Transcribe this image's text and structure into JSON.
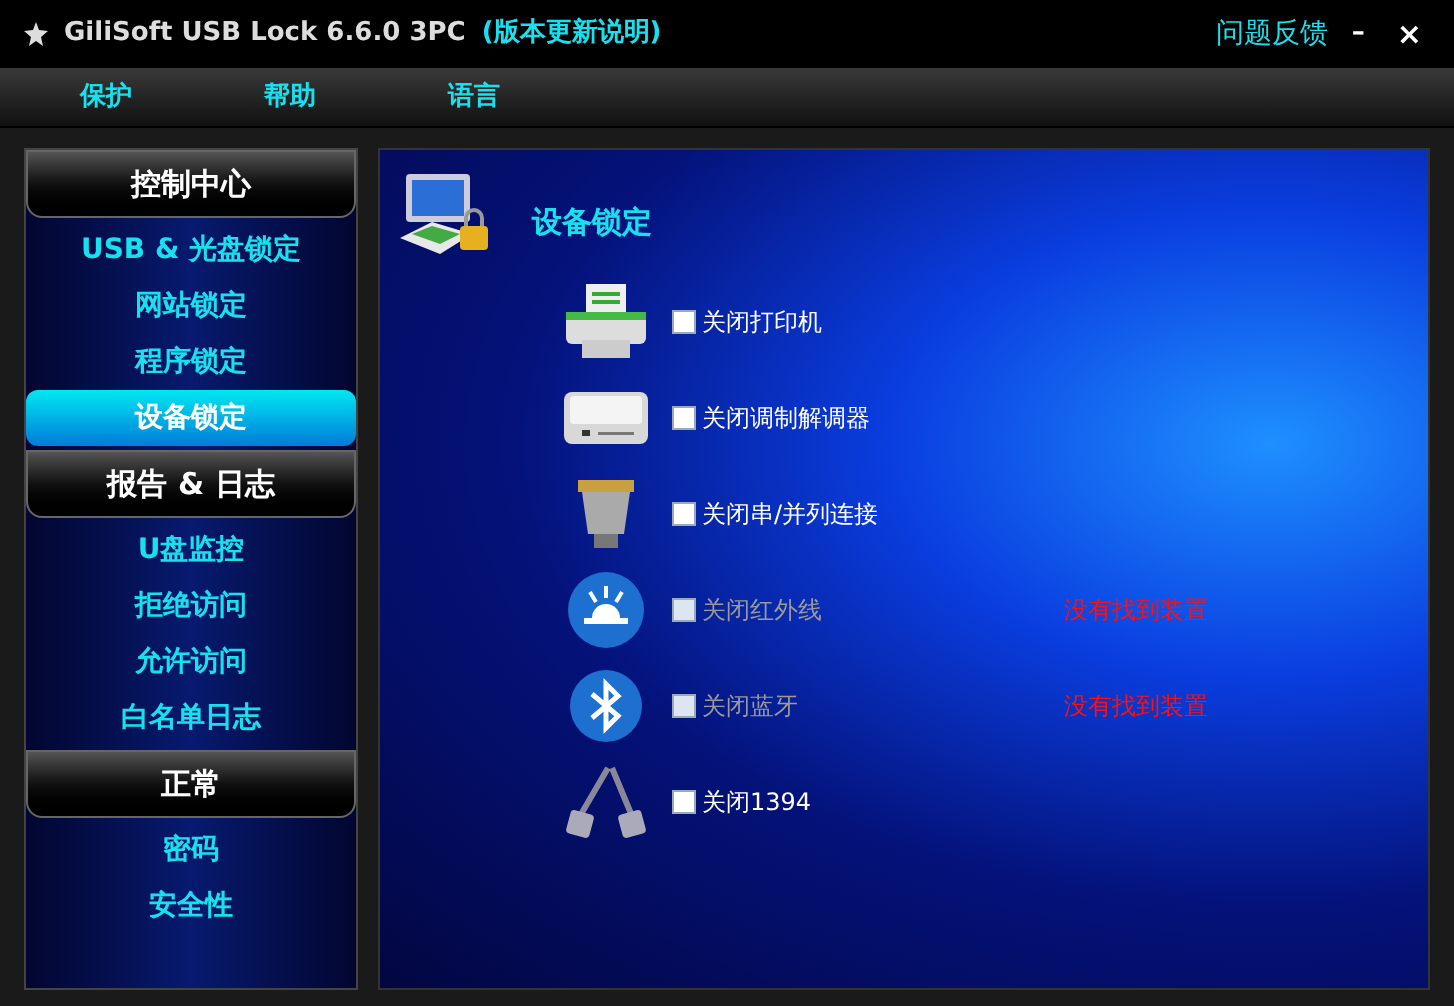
{
  "window": {
    "title": "GiliSoft USB Lock 6.6.0 3PC",
    "title_link": "(版本更新说明)",
    "feedback": "问题反馈",
    "minimize": "–",
    "close": "×"
  },
  "menu": [
    "保护",
    "帮助",
    "语言"
  ],
  "sidebar": [
    {
      "header": "控制中心",
      "items": [
        {
          "label": "USB & 光盘锁定",
          "selected": false
        },
        {
          "label": "网站锁定",
          "selected": false
        },
        {
          "label": "程序锁定",
          "selected": false
        },
        {
          "label": "设备锁定",
          "selected": true
        }
      ]
    },
    {
      "header": "报告 & 日志",
      "items": [
        {
          "label": "U盘监控",
          "selected": false
        },
        {
          "label": "拒绝访问",
          "selected": false
        },
        {
          "label": "允许访问",
          "selected": false
        },
        {
          "label": "白名单日志",
          "selected": false
        }
      ]
    },
    {
      "header": "正常",
      "items": [
        {
          "label": "密码",
          "selected": false
        },
        {
          "label": "安全性",
          "selected": false
        }
      ]
    }
  ],
  "content": {
    "title": "设备锁定",
    "devices": [
      {
        "kind": "printer",
        "label": "关闭打印机",
        "checked": false,
        "disabled": false
      },
      {
        "kind": "modem",
        "label": "关闭调制解调器",
        "checked": false,
        "disabled": false
      },
      {
        "kind": "port",
        "label": "关闭串/并列连接",
        "checked": false,
        "disabled": false
      },
      {
        "kind": "infrared",
        "label": "关闭红外线",
        "checked": false,
        "disabled": true,
        "status": "没有找到装置"
      },
      {
        "kind": "bluetooth",
        "label": "关闭蓝牙",
        "checked": false,
        "disabled": true,
        "status": "没有找到装置"
      },
      {
        "kind": "firewire",
        "label": "关闭1394",
        "checked": false,
        "disabled": false
      }
    ]
  }
}
